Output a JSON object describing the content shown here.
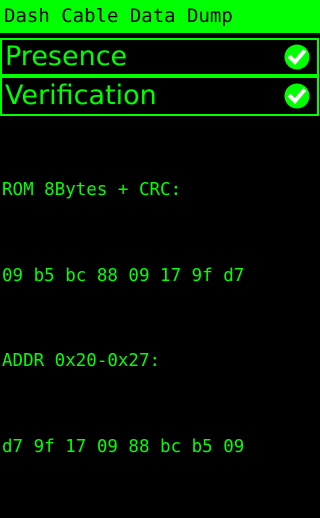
{
  "header": {
    "title": "Dash Cable Data Dump"
  },
  "checks": [
    {
      "label": "Presence",
      "status": "passed",
      "icon": "check-circle-icon"
    },
    {
      "label": "Verification",
      "status": "passed",
      "icon": "check-circle-icon"
    }
  ],
  "dump": {
    "rom_label": "ROM 8Bytes + CRC:",
    "rom_bytes": "09 b5 bc 88 09 17 9f d7",
    "addr_label": "ADDR 0x20-0x27:",
    "addr_bytes": "d7 9f 17 09 88 bc b5 09"
  },
  "colors": {
    "background": "#000000",
    "accent": "#00ff00",
    "title_text": "#000000",
    "check_fill": "#00ff00",
    "check_mark": "#ffffff"
  }
}
